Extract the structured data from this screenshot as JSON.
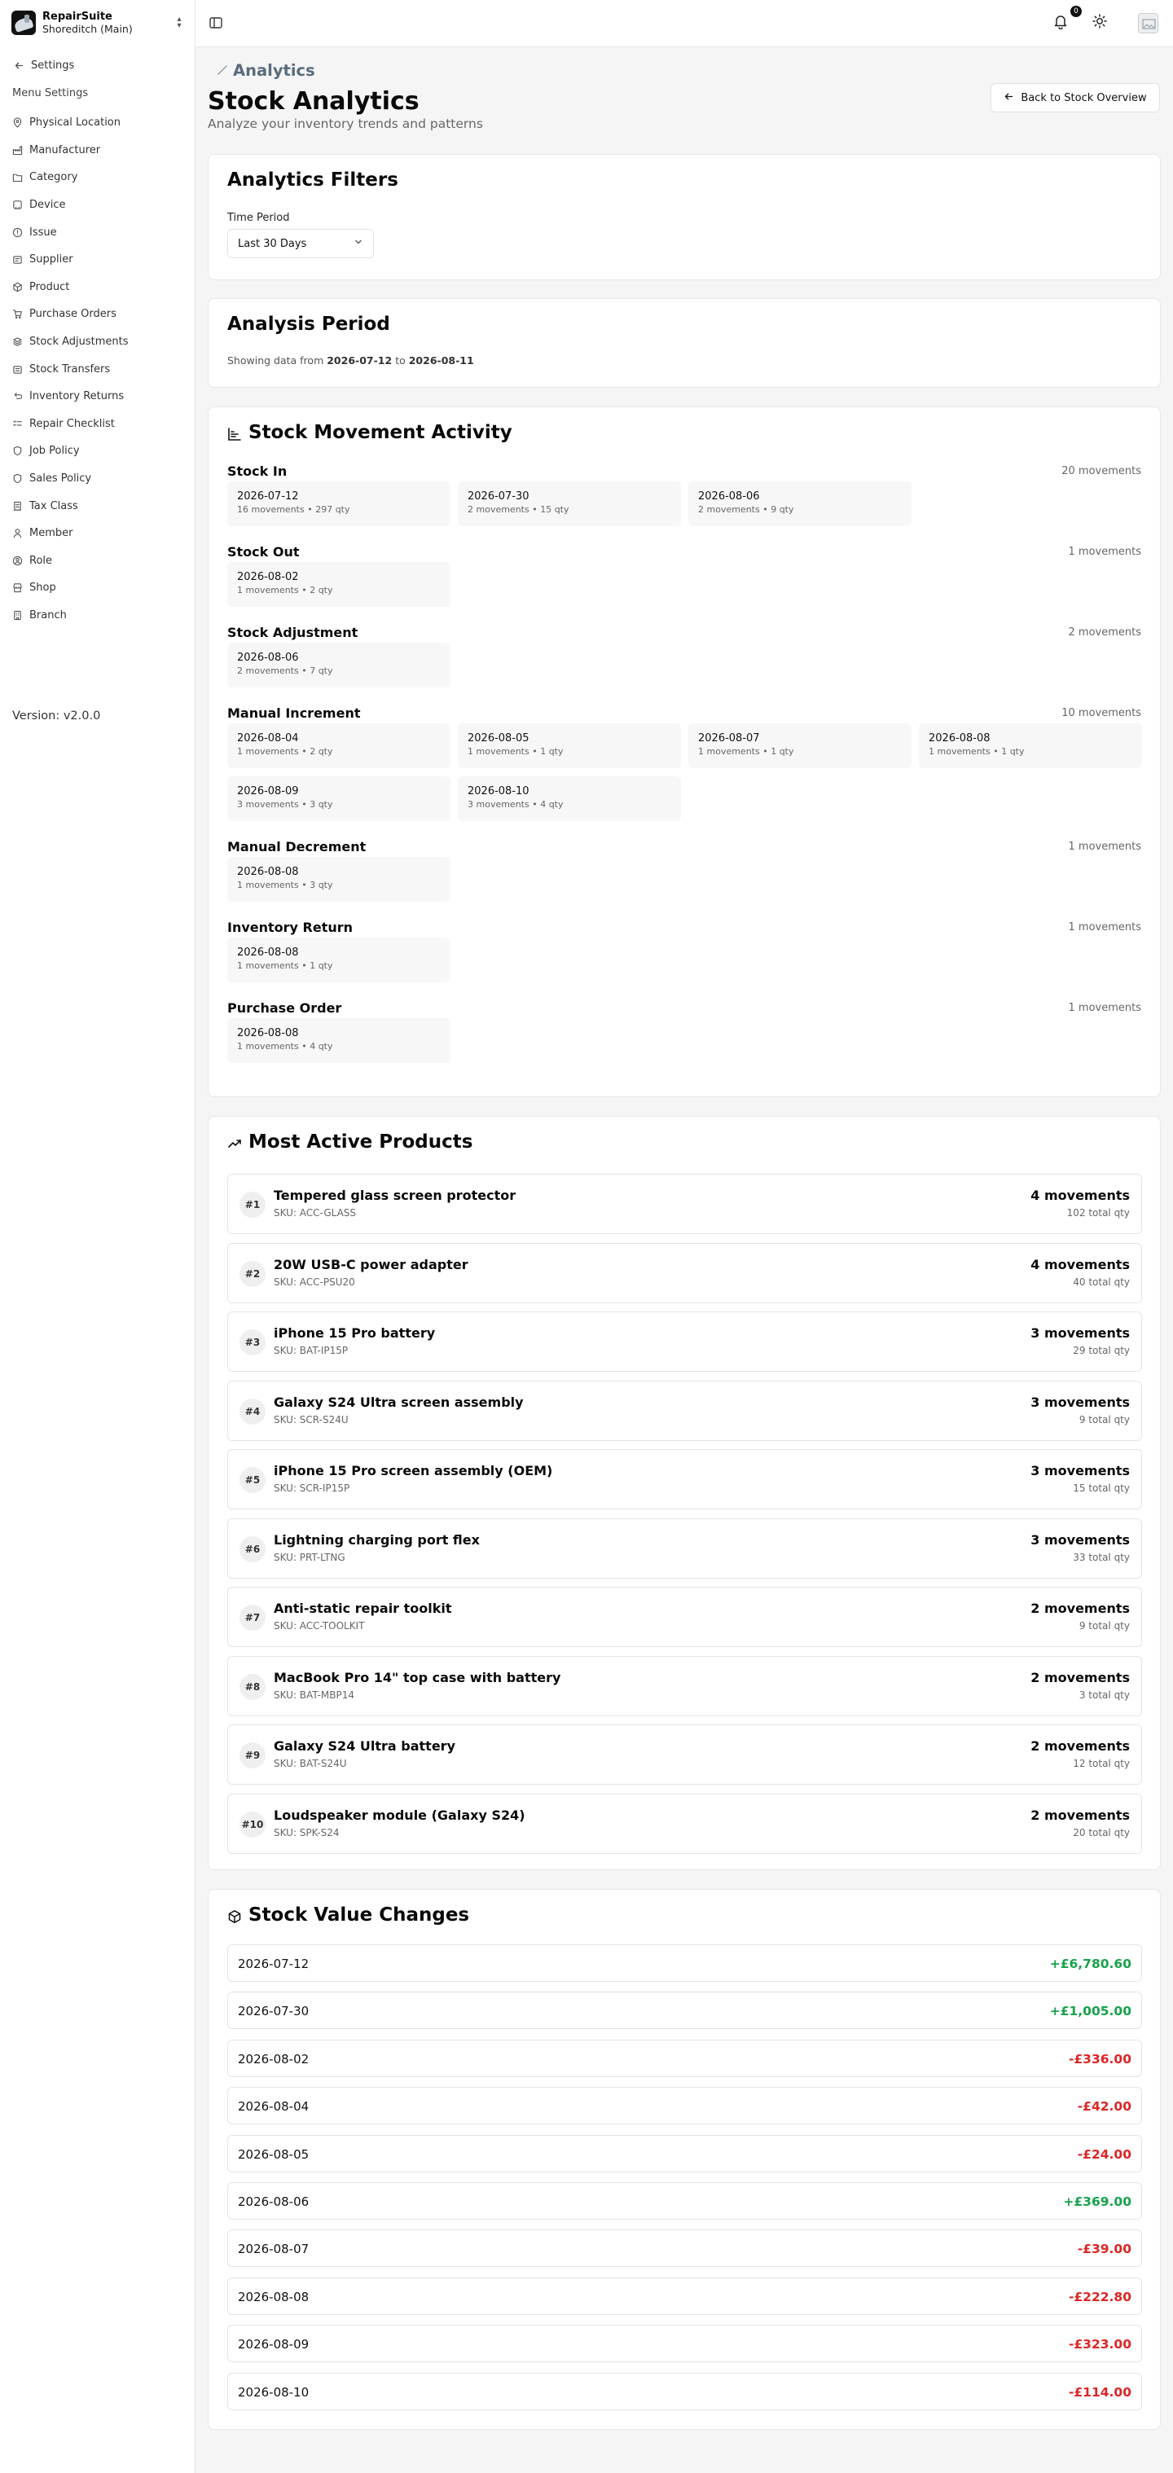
{
  "app": {
    "name": "RepairSuite",
    "branch": "Shoreditch (Main)",
    "version": "Version: v2.0.0"
  },
  "sidebar": {
    "back_label": "Settings",
    "section_label": "Menu Settings",
    "items": [
      {
        "label": "Physical Location",
        "icon": "map-pin-icon"
      },
      {
        "label": "Manufacturer",
        "icon": "factory-icon"
      },
      {
        "label": "Category",
        "icon": "folder-icon"
      },
      {
        "label": "Device",
        "icon": "device-icon"
      },
      {
        "label": "Issue",
        "icon": "alert-icon"
      },
      {
        "label": "Supplier",
        "icon": "supplier-icon"
      },
      {
        "label": "Product",
        "icon": "package-icon"
      },
      {
        "label": "Purchase Orders",
        "icon": "cart-icon"
      },
      {
        "label": "Stock Adjustments",
        "icon": "stack-icon"
      },
      {
        "label": "Stock Transfers",
        "icon": "transfer-icon"
      },
      {
        "label": "Inventory Returns",
        "icon": "return-icon"
      },
      {
        "label": "Repair Checklist",
        "icon": "checklist-icon"
      },
      {
        "label": "Job Policy",
        "icon": "shield-icon"
      },
      {
        "label": "Sales Policy",
        "icon": "shield-icon"
      },
      {
        "label": "Tax Class",
        "icon": "receipt-icon"
      },
      {
        "label": "Member",
        "icon": "user-icon"
      },
      {
        "label": "Role",
        "icon": "role-icon"
      },
      {
        "label": "Shop",
        "icon": "shop-icon"
      },
      {
        "label": "Branch",
        "icon": "building-icon"
      }
    ]
  },
  "topbar": {
    "notification_count": "0"
  },
  "header": {
    "breadcrumb": "Analytics",
    "title": "Stock Analytics",
    "subtitle": "Analyze your inventory trends and patterns",
    "back_button": "Back to Stock Overview"
  },
  "filters": {
    "title": "Analytics Filters",
    "time_period_label": "Time Period",
    "time_period_value": "Last 30 Days"
  },
  "period": {
    "title": "Analysis Period",
    "prefix": "Showing data from",
    "from": "2026-07-12",
    "joiner": "to",
    "to": "2026-08-11"
  },
  "movement": {
    "title": "Stock Movement Activity",
    "groups": [
      {
        "name": "Stock In",
        "count": "20 movements",
        "entries": [
          {
            "date": "2026-07-12",
            "meta": "16 movements • 297 qty"
          },
          {
            "date": "2026-07-30",
            "meta": "2 movements • 15 qty"
          },
          {
            "date": "2026-08-06",
            "meta": "2 movements • 9 qty"
          }
        ]
      },
      {
        "name": "Stock Out",
        "count": "1 movements",
        "entries": [
          {
            "date": "2026-08-02",
            "meta": "1 movements • 2 qty"
          }
        ]
      },
      {
        "name": "Stock Adjustment",
        "count": "2 movements",
        "entries": [
          {
            "date": "2026-08-06",
            "meta": "2 movements • 7 qty"
          }
        ]
      },
      {
        "name": "Manual Increment",
        "count": "10 movements",
        "entries": [
          {
            "date": "2026-08-04",
            "meta": "1 movements • 2 qty"
          },
          {
            "date": "2026-08-05",
            "meta": "1 movements • 1 qty"
          },
          {
            "date": "2026-08-07",
            "meta": "1 movements • 1 qty"
          },
          {
            "date": "2026-08-08",
            "meta": "1 movements • 1 qty"
          },
          {
            "date": "2026-08-09",
            "meta": "3 movements • 3 qty"
          },
          {
            "date": "2026-08-10",
            "meta": "3 movements • 4 qty"
          }
        ]
      },
      {
        "name": "Manual Decrement",
        "count": "1 movements",
        "entries": [
          {
            "date": "2026-08-08",
            "meta": "1 movements • 3 qty"
          }
        ]
      },
      {
        "name": "Inventory Return",
        "count": "1 movements",
        "entries": [
          {
            "date": "2026-08-08",
            "meta": "1 movements • 1 qty"
          }
        ]
      },
      {
        "name": "Purchase Order",
        "count": "1 movements",
        "entries": [
          {
            "date": "2026-08-08",
            "meta": "1 movements • 4 qty"
          }
        ]
      }
    ]
  },
  "products": {
    "title": "Most Active Products",
    "items": [
      {
        "rank": "#1",
        "name": "Tempered glass screen protector",
        "sku": "SKU: ACC-GLASS",
        "movements": "4 movements",
        "qty": "102 total qty"
      },
      {
        "rank": "#2",
        "name": "20W USB-C power adapter",
        "sku": "SKU: ACC-PSU20",
        "movements": "4 movements",
        "qty": "40 total qty"
      },
      {
        "rank": "#3",
        "name": "iPhone 15 Pro battery",
        "sku": "SKU: BAT-IP15P",
        "movements": "3 movements",
        "qty": "29 total qty"
      },
      {
        "rank": "#4",
        "name": "Galaxy S24 Ultra screen assembly",
        "sku": "SKU: SCR-S24U",
        "movements": "3 movements",
        "qty": "9 total qty"
      },
      {
        "rank": "#5",
        "name": "iPhone 15 Pro screen assembly (OEM)",
        "sku": "SKU: SCR-IP15P",
        "movements": "3 movements",
        "qty": "15 total qty"
      },
      {
        "rank": "#6",
        "name": "Lightning charging port flex",
        "sku": "SKU: PRT-LTNG",
        "movements": "3 movements",
        "qty": "33 total qty"
      },
      {
        "rank": "#7",
        "name": "Anti-static repair toolkit",
        "sku": "SKU: ACC-TOOLKIT",
        "movements": "2 movements",
        "qty": "9 total qty"
      },
      {
        "rank": "#8",
        "name": "MacBook Pro 14\" top case with battery",
        "sku": "SKU: BAT-MBP14",
        "movements": "2 movements",
        "qty": "3 total qty"
      },
      {
        "rank": "#9",
        "name": "Galaxy S24 Ultra battery",
        "sku": "SKU: BAT-S24U",
        "movements": "2 movements",
        "qty": "12 total qty"
      },
      {
        "rank": "#10",
        "name": "Loudspeaker module (Galaxy S24)",
        "sku": "SKU: SPK-S24",
        "movements": "2 movements",
        "qty": "20 total qty"
      }
    ]
  },
  "value_changes": {
    "title": "Stock Value Changes",
    "items": [
      {
        "date": "2026-07-12",
        "amount": "+£6,780.60",
        "direction": "pos"
      },
      {
        "date": "2026-07-30",
        "amount": "+£1,005.00",
        "direction": "pos"
      },
      {
        "date": "2026-08-02",
        "amount": "-£336.00",
        "direction": "neg"
      },
      {
        "date": "2026-08-04",
        "amount": "-£42.00",
        "direction": "neg"
      },
      {
        "date": "2026-08-05",
        "amount": "-£24.00",
        "direction": "neg"
      },
      {
        "date": "2026-08-06",
        "amount": "+£369.00",
        "direction": "pos"
      },
      {
        "date": "2026-08-07",
        "amount": "-£39.00",
        "direction": "neg"
      },
      {
        "date": "2026-08-08",
        "amount": "-£222.80",
        "direction": "neg"
      },
      {
        "date": "2026-08-09",
        "amount": "-£323.00",
        "direction": "neg"
      },
      {
        "date": "2026-08-10",
        "amount": "-£114.00",
        "direction": "neg"
      }
    ]
  },
  "colors": {
    "positive": "#16a34a",
    "negative": "#dc2626",
    "breadcrumb": "#5a6b7d"
  }
}
